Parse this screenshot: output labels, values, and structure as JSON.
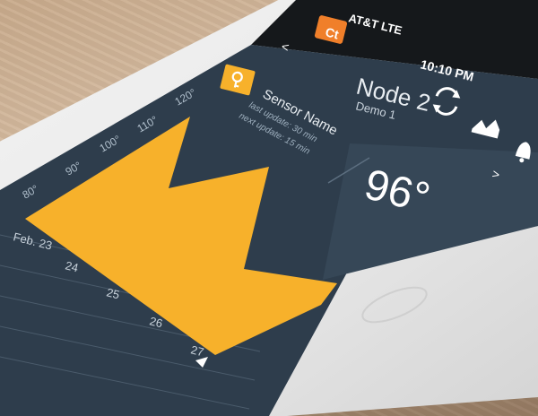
{
  "status_bar": {
    "carrier": "AT&T LTE",
    "time": "10:10 PM"
  },
  "app": {
    "logo_text": "Ct",
    "back_chevron": "<",
    "colors": {
      "accent": "#f7b12b",
      "orange": "#f07f2a",
      "panel": "#2e3d4c",
      "panel_light": "#364757",
      "text": "#e8edf1"
    }
  },
  "node": {
    "title": "Node 2",
    "subtitle": "Demo 1"
  },
  "sensor": {
    "name": "Sensor Name",
    "last_update": "last update: 30 min",
    "next_update": "next update: 15 min",
    "icon": "key-icon"
  },
  "reading": {
    "temperature": "96°"
  },
  "toolbar": {
    "icons": [
      "refresh-icon",
      "chart-icon",
      "bell-icon"
    ]
  },
  "chart_data": {
    "type": "area",
    "y_ticks": [
      "80°",
      "90°",
      "100°",
      "110°",
      "120°"
    ],
    "x_ticks": [
      "Feb. 23",
      "24",
      "25",
      "26",
      "27"
    ],
    "ylim": [
      80,
      120
    ]
  }
}
